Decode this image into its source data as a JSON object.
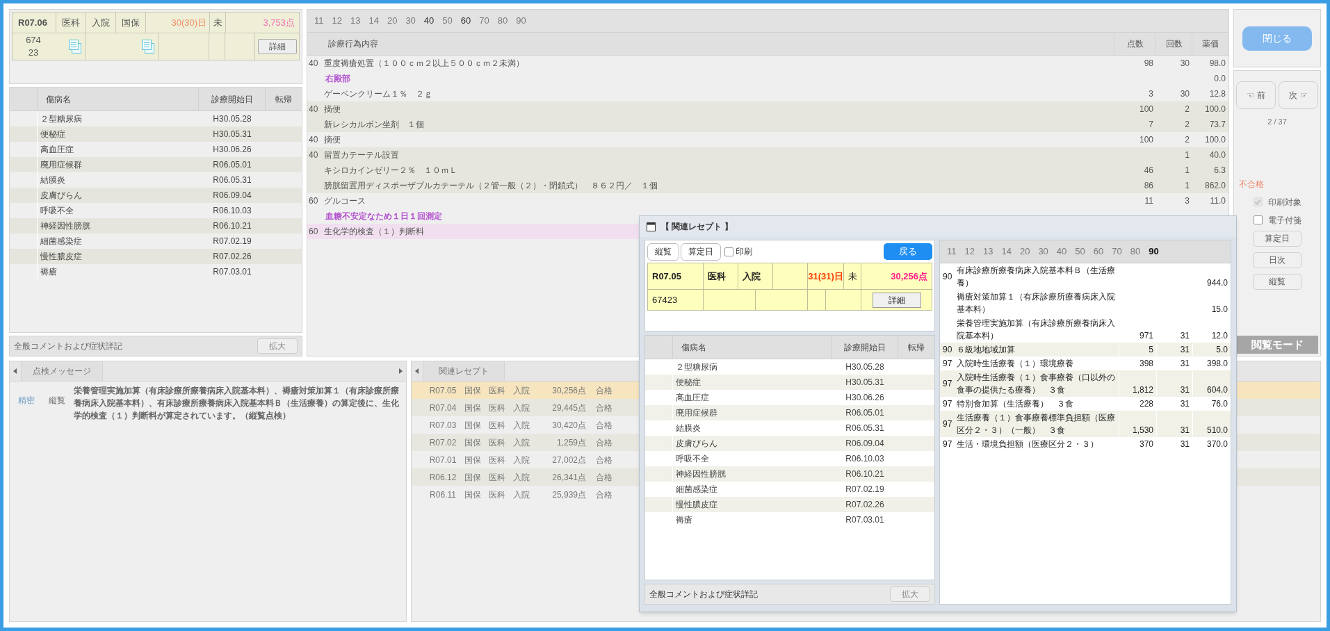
{
  "receipt": {
    "period": "R07.06",
    "dept": "医科",
    "type": "入院",
    "insurer": "国保",
    "days": "30(30)日",
    "status": "未",
    "points": "3,753点",
    "id_lines": [
      "674",
      "23"
    ],
    "detail_button": "詳細"
  },
  "diseases": {
    "columns": [
      "傷病名",
      "診療開始日",
      "転帰"
    ],
    "rows": [
      {
        "name": "２型糖尿病",
        "start": "H30.05.28"
      },
      {
        "name": "便秘症",
        "start": "H30.05.31"
      },
      {
        "name": "高血圧症",
        "start": "H30.06.26"
      },
      {
        "name": "廃用症候群",
        "start": "R06.05.01"
      },
      {
        "name": "結膜炎",
        "start": "R06.05.31"
      },
      {
        "name": "皮膚びらん",
        "start": "R06.09.04"
      },
      {
        "name": "呼吸不全",
        "start": "R06.10.03"
      },
      {
        "name": "神経因性膀胱",
        "start": "R06.10.21"
      },
      {
        "name": "細菌感染症",
        "start": "R07.02.19"
      },
      {
        "name": "慢性膿皮症",
        "start": "R07.02.26"
      },
      {
        "name": "褥瘡",
        "start": "R07.03.01"
      }
    ]
  },
  "comment_bar": {
    "label": "全般コメントおよび症状詳記",
    "button": "拡大"
  },
  "procedure_tabs": [
    {
      "label": "11",
      "has_items": false
    },
    {
      "label": "12",
      "has_items": false
    },
    {
      "label": "13",
      "has_items": false
    },
    {
      "label": "14",
      "has_items": false
    },
    {
      "label": "20",
      "has_items": false
    },
    {
      "label": "30",
      "has_items": false
    },
    {
      "label": "40",
      "has_items": true
    },
    {
      "label": "50",
      "has_items": false
    },
    {
      "label": "60",
      "has_items": true
    },
    {
      "label": "70",
      "has_items": false
    },
    {
      "label": "80",
      "has_items": false
    },
    {
      "label": "90",
      "has_items": false
    }
  ],
  "procedures": {
    "columns": [
      "診療行為内容",
      "点数",
      "回数",
      "薬価"
    ],
    "groups": [
      {
        "code": "40",
        "selected": false,
        "lines": [
          {
            "kind": "item",
            "text": "重度褥瘡処置（１００ｃｍ２以上５００ｃｍ２未満）",
            "points": "98",
            "count": "30",
            "price": "98.0"
          },
          {
            "kind": "comment",
            "text": "右殿部",
            "price": "0.0"
          },
          {
            "kind": "item",
            "text": "ゲーベンクリーム１％　２ｇ",
            "points": "3",
            "count": "30",
            "price": "12.8"
          }
        ]
      },
      {
        "code": "40",
        "selected": false,
        "lines": [
          {
            "kind": "item",
            "text": "摘便",
            "points": "100",
            "count": "2",
            "price": "100.0"
          },
          {
            "kind": "item",
            "text": "新レシカルボン坐剤　１個",
            "points": "7",
            "count": "2",
            "price": "73.7"
          }
        ]
      },
      {
        "code": "40",
        "selected": false,
        "lines": [
          {
            "kind": "item",
            "text": "摘便",
            "points": "100",
            "count": "2",
            "price": "100.0"
          }
        ]
      },
      {
        "code": "40",
        "selected": false,
        "lines": [
          {
            "kind": "item",
            "text": "留置カテーテル設置",
            "count": "1",
            "price": "40.0"
          },
          {
            "kind": "item",
            "text": "キシロカインゼリー２％　１０ｍＬ",
            "points": "46",
            "count": "1",
            "price": "6.3"
          },
          {
            "kind": "item",
            "text": "膀胱留置用ディスポーザブルカテーテル（２管一般（２）・閉鎖式）　８６２円／　１個",
            "points": "86",
            "count": "1",
            "price": "862.0"
          }
        ]
      },
      {
        "code": "60",
        "selected": false,
        "lines": [
          {
            "kind": "item",
            "text": "グルコース",
            "points": "11",
            "count": "3",
            "price": "11.0"
          },
          {
            "kind": "comment",
            "text": "血糖不安定なため１日１回測定"
          }
        ]
      },
      {
        "code": "60",
        "selected": true,
        "lines": [
          {
            "kind": "item",
            "text": "生化学的検査（１）判断料"
          }
        ]
      }
    ]
  },
  "side": {
    "close_button": "閉じる",
    "prev_button": "☜ 前",
    "next_button": "次 ☞",
    "page": "2 / 37",
    "result": "不合格",
    "checkboxes": [
      {
        "label": "印刷対象",
        "checked": true,
        "disabled": true
      },
      {
        "label": "電子付箋",
        "checked": false,
        "disabled": false
      }
    ],
    "buttons": [
      "算定日",
      "日次",
      "縦覧"
    ],
    "mode": "閲覧モード"
  },
  "check_messages": {
    "tab": "点検メッセージ",
    "rows": [
      {
        "level": "精密",
        "type": "縦覧",
        "message": "栄養管理実施加算（有床診療所療養病床入院基本料）、褥瘡対策加算１（有床診療所療養病床入院基本料）、有床診療所療養病床入院基本料Ｂ（生活療養）の算定後に、生化学的検査（１）判断料が算定されています。（縦覧点検）"
      }
    ]
  },
  "related_receipts": {
    "tab": "関連レセプト",
    "rows": [
      {
        "month": "R07.05",
        "insurer": "国保",
        "dept": "医科",
        "type": "入院",
        "points": "30,256点",
        "result": "合格",
        "selected": true
      },
      {
        "month": "R07.04",
        "insurer": "国保",
        "dept": "医科",
        "type": "入院",
        "points": "29,445点",
        "result": "合格",
        "selected": false
      },
      {
        "month": "R07.03",
        "insurer": "国保",
        "dept": "医科",
        "type": "入院",
        "points": "30,420点",
        "result": "合格",
        "selected": false
      },
      {
        "month": "R07.02",
        "insurer": "国保",
        "dept": "医科",
        "type": "入院",
        "points": "1,259点",
        "result": "合格",
        "selected": false
      },
      {
        "month": "R07.01",
        "insurer": "国保",
        "dept": "医科",
        "type": "入院",
        "points": "27,002点",
        "result": "合格",
        "selected": false
      },
      {
        "month": "R06.12",
        "insurer": "国保",
        "dept": "医科",
        "type": "入院",
        "points": "26,341点",
        "result": "合格",
        "selected": false
      },
      {
        "month": "R06.11",
        "insurer": "国保",
        "dept": "医科",
        "type": "入院",
        "points": "25,939点",
        "result": "合格",
        "selected": false
      }
    ]
  },
  "dialog": {
    "title": "【 関連レセプト 】",
    "buttons": [
      "縦覧",
      "算定日"
    ],
    "print_checkbox": {
      "label": "印刷",
      "checked": false
    },
    "back_button": "戻る",
    "receipt": {
      "period": "R07.05",
      "dept": "医科",
      "type": "入院",
      "days": "31(31)日",
      "status": "未",
      "points": "30,256点",
      "id": "67423",
      "detail_button": "詳細"
    },
    "diseases": {
      "columns": [
        "傷病名",
        "診療開始日",
        "転帰"
      ],
      "rows": [
        {
          "name": "２型糖尿病",
          "start": "H30.05.28"
        },
        {
          "name": "便秘症",
          "start": "H30.05.31"
        },
        {
          "name": "高血圧症",
          "start": "H30.06.26"
        },
        {
          "name": "廃用症候群",
          "start": "R06.05.01"
        },
        {
          "name": "結膜炎",
          "start": "R06.05.31"
        },
        {
          "name": "皮膚びらん",
          "start": "R06.09.04"
        },
        {
          "name": "呼吸不全",
          "start": "R06.10.03"
        },
        {
          "name": "神経因性膀胱",
          "start": "R06.10.21"
        },
        {
          "name": "細菌感染症",
          "start": "R07.02.19"
        },
        {
          "name": "慢性膿皮症",
          "start": "R07.02.26"
        },
        {
          "name": "褥瘡",
          "start": "R07.03.01"
        }
      ]
    },
    "comment_bar": {
      "label": "全般コメントおよび症状詳記",
      "button": "拡大"
    },
    "tabs": [
      {
        "label": "11",
        "has_items": false
      },
      {
        "label": "12",
        "has_items": false
      },
      {
        "label": "13",
        "has_items": false
      },
      {
        "label": "14",
        "has_items": false
      },
      {
        "label": "20",
        "has_items": false
      },
      {
        "label": "30",
        "has_items": false
      },
      {
        "label": "40",
        "has_items": false
      },
      {
        "label": "50",
        "has_items": false
      },
      {
        "label": "60",
        "has_items": false
      },
      {
        "label": "70",
        "has_items": false
      },
      {
        "label": "80",
        "has_items": false
      },
      {
        "label": "90",
        "has_items": true
      }
    ],
    "groups": [
      {
        "code": "90",
        "lines": [
          {
            "text": "有床診療所療養病床入院基本料Ｂ（生活療養）",
            "price": "944.0"
          },
          {
            "text": "褥瘡対策加算１（有床診療所療養病床入院基本料）",
            "price": "15.0"
          },
          {
            "text": "栄養管理実施加算（有床診療所療養病床入院基本料）",
            "points": "971",
            "count": "31",
            "price": "12.0"
          }
        ]
      },
      {
        "code": "90",
        "lines": [
          {
            "text": "６級地地域加算",
            "points": "5",
            "count": "31",
            "price": "5.0"
          }
        ]
      },
      {
        "code": "97",
        "lines": [
          {
            "text": "入院時生活療養（１）環境療養",
            "points": "398",
            "count": "31",
            "price": "398.0"
          }
        ]
      },
      {
        "code": "97",
        "lines": [
          {
            "text": "入院時生活療養（１）食事療養（口以外の食事の提供たる療養）　３食",
            "points": "1,812",
            "count": "31",
            "price": "604.0"
          }
        ]
      },
      {
        "code": "97",
        "lines": [
          {
            "text": "特別食加算（生活療養）　３食",
            "points": "228",
            "count": "31",
            "price": "76.0"
          }
        ]
      },
      {
        "code": "97",
        "lines": [
          {
            "text": "生活療養（１）食事療養標準負担額（医療区分２・３）（一般）　３食",
            "points": "1,530",
            "count": "31",
            "price": "510.0"
          }
        ]
      },
      {
        "code": "97",
        "lines": [
          {
            "text": "生活・環境負担額（医療区分２・３）",
            "points": "370",
            "count": "31",
            "price": "370.0"
          }
        ]
      }
    ]
  }
}
